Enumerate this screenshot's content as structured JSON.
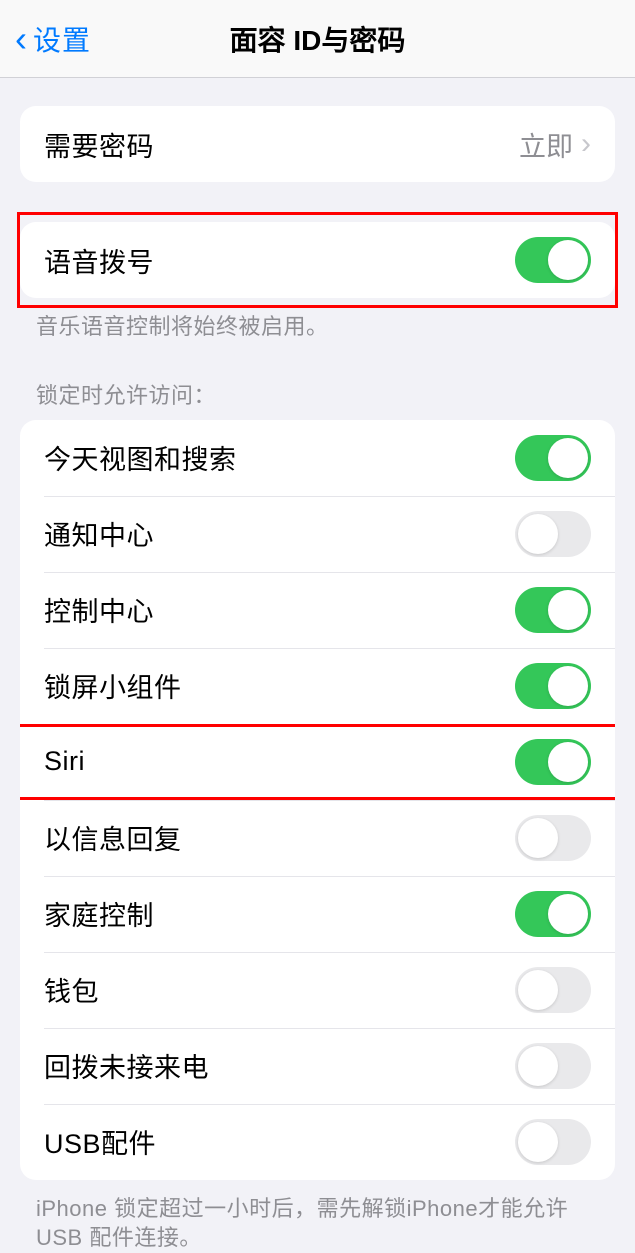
{
  "header": {
    "back_label": "设置",
    "title": "面容 ID与密码"
  },
  "group_passcode": {
    "label": "需要密码",
    "value": "立即"
  },
  "group_voice": {
    "label": "语音拨号",
    "enabled": true,
    "footer": "音乐语音控制将始终被启用。"
  },
  "group_locked": {
    "header": "锁定时允许访问：",
    "items": [
      {
        "label": "今天视图和搜索",
        "enabled": true
      },
      {
        "label": "通知中心",
        "enabled": false
      },
      {
        "label": "控制中心",
        "enabled": true
      },
      {
        "label": "锁屏小组件",
        "enabled": true
      },
      {
        "label": "Siri",
        "enabled": true
      },
      {
        "label": "以信息回复",
        "enabled": false
      },
      {
        "label": "家庭控制",
        "enabled": true
      },
      {
        "label": "钱包",
        "enabled": false
      },
      {
        "label": "回拨未接来电",
        "enabled": false
      },
      {
        "label": "USB配件",
        "enabled": false
      }
    ],
    "footer": "iPhone 锁定超过一小时后，需先解锁iPhone才能允许 USB 配件连接。"
  },
  "highlight_indices": [
    0,
    5
  ]
}
